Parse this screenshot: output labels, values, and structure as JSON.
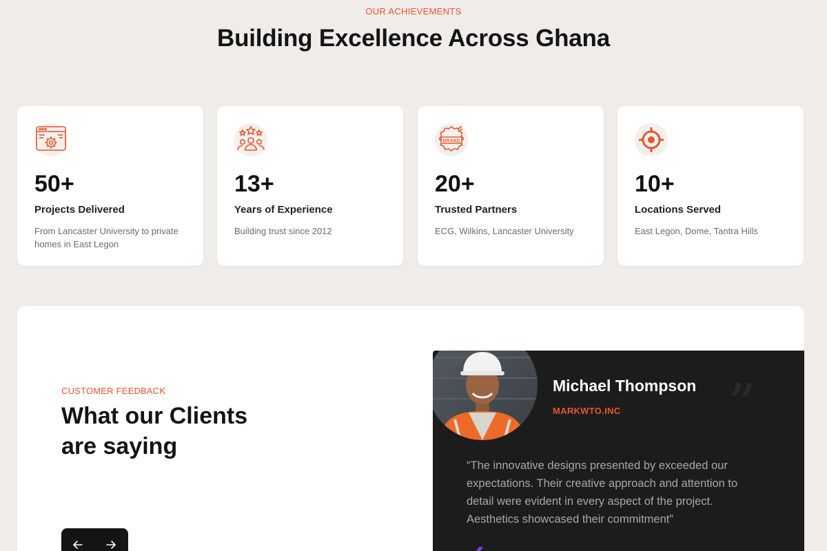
{
  "achievements": {
    "eyebrow": "OUR ACHIEVEMENTS",
    "title": "Building Excellence Across Ghana",
    "cards": [
      {
        "icon": "gear-settings-icon",
        "stat": "50+",
        "label": "Projects Delivered",
        "desc": "From Lancaster University to private homes in East Legon"
      },
      {
        "icon": "team-stars-icon",
        "stat": "13+",
        "label": "Years of Experience",
        "desc": "Building trust since 2012"
      },
      {
        "icon": "brand-badge-icon",
        "stat": "20+",
        "label": "Trusted Partners",
        "desc": "ECG, Wilkins, Lancaster University"
      },
      {
        "icon": "target-icon",
        "stat": "10+",
        "label": "Locations Served",
        "desc": "East Legon, Dome, Tantra Hills"
      }
    ]
  },
  "feedback": {
    "eyebrow": "CUSTOMER FEEDBACK",
    "title": "What our Clients are saying",
    "nav": {
      "prev_icon": "arrow-left-icon",
      "next_icon": "arrow-right-icon"
    },
    "testimonial": {
      "name": "Michael Thompson",
      "company": "MARKWTO.INC",
      "quote": "“The innovative designs presented by exceeded our expectations. Their creative approach and attention to detail were evident in every aspect of the project. Aesthetics showcased their commitment”",
      "quote_mark": "”"
    }
  },
  "colors": {
    "accent": "#e4572e",
    "background": "#efece9",
    "dark": "#1c1c1c"
  }
}
